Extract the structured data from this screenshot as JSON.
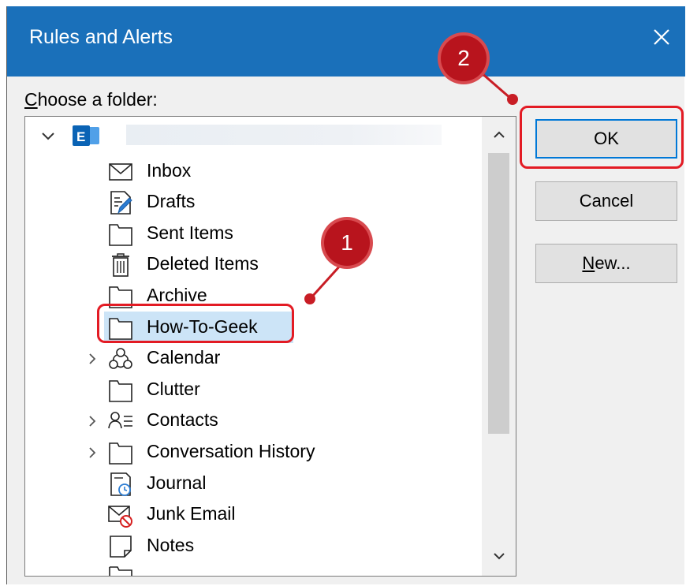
{
  "dialog": {
    "title": "Rules and Alerts",
    "close_icon": "close-icon",
    "label_accel": "C",
    "label_rest": "hoose a folder:"
  },
  "tree": {
    "account_icon": "exchange-account-icon",
    "items": [
      {
        "label": "Inbox",
        "icon": "envelope-icon"
      },
      {
        "label": "Drafts",
        "icon": "draft-icon"
      },
      {
        "label": "Sent Items",
        "icon": "folder-icon"
      },
      {
        "label": "Deleted Items",
        "icon": "trash-icon"
      },
      {
        "label": "Archive",
        "icon": "folder-icon"
      },
      {
        "label": "How-To-Geek",
        "icon": "folder-icon",
        "selected": true
      },
      {
        "label": "Calendar",
        "icon": "calendar-shared-icon",
        "expandable": true
      },
      {
        "label": "Clutter",
        "icon": "folder-icon"
      },
      {
        "label": "Contacts",
        "icon": "contacts-icon",
        "expandable": true
      },
      {
        "label": "Conversation History",
        "icon": "folder-icon",
        "expandable": true
      },
      {
        "label": "Journal",
        "icon": "journal-icon"
      },
      {
        "label": "Junk Email",
        "icon": "junk-email-icon"
      },
      {
        "label": "Notes",
        "icon": "notes-icon"
      }
    ]
  },
  "buttons": {
    "ok": "OK",
    "cancel": "Cancel",
    "new_accel": "N",
    "new_rest": "ew..."
  },
  "callouts": {
    "one": "1",
    "two": "2"
  },
  "colors": {
    "titlebar": "#1a70ba",
    "callout": "#b8141d",
    "highlight": "#e31b24",
    "selection": "#cce4f7"
  }
}
